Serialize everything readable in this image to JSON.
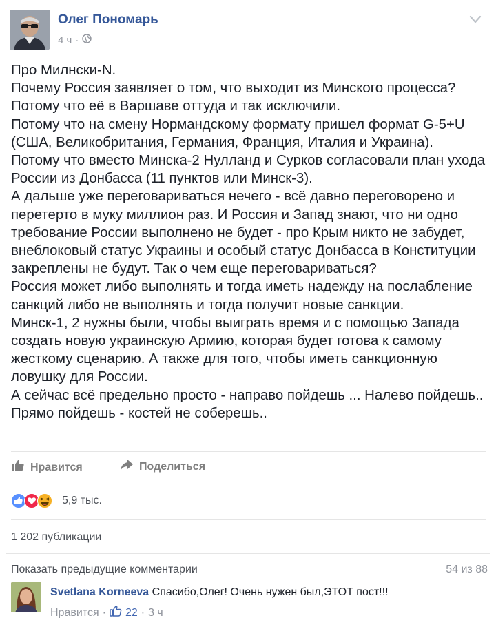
{
  "post": {
    "author": "Олег Пономарь",
    "time": "4 ч",
    "separator": "·",
    "lines": [
      "Про Милнски-N.",
      "Почему Россия заявляет о том, что выходит из Минского процесса?",
      "Потому что её в Варшаве оттуда и так исключили.",
      "Потому что на смену Нормандскому формату пришел формат G-5+U",
      "(США, Великобритания, Германия, Франция, Италия и Украина).",
      "Потому что вместо Минска-2 Нулланд и Сурков согласовали план ухода",
      "России из Донбасса (11 пунктов или Минск-3).",
      "А дальше уже переговариваться нечего - всё давно переговорено и",
      "перетерто в муку миллион раз. И Россия и Запад знают, что ни одно",
      "требование России выполнено не будет - про Крым никто не забудет,",
      "внеблоковый статус Украины и особый статус Донбасса в Конституции",
      "закреплены не будут. Так о чем еще переговариваться?",
      "Россия может либо выполнять и тогда иметь надежду на послабление",
      "санкций либо не выполнять и тогда получит новые санкции.",
      "Минск-1, 2 нужны были, чтобы выиграть время и с помощью Запада",
      "создать новую украинскую Армию, которая будет готова к самому",
      "жесткому сценарию. А также для того, чтобы иметь санкционную",
      "ловушку для России.",
      "А сейчас всё предельно просто - направо пойдешь ... Налево пойдешь..",
      "Прямо пойдешь - костей не соберешь.."
    ]
  },
  "actions": {
    "like_label": "Нравится",
    "share_label": "Поделиться"
  },
  "reactions": {
    "count": "5,9 тыс.",
    "icons": [
      "like-reaction-icon",
      "love-reaction-icon",
      "haha-reaction-icon"
    ]
  },
  "shares": {
    "label": "1 202 публикации"
  },
  "comments": {
    "show_previous": "Показать предыдущие комментарии",
    "counter": "54 из 88",
    "items": [
      {
        "author": "Svetlana Korneeva",
        "text": " Спасибо,Олег! Очень нужен был,ЭТОТ пост!!!",
        "like_label": "Нравится",
        "like_count": "22",
        "time": "3 ч",
        "separator": "·"
      }
    ]
  },
  "colors": {
    "link": "#365899",
    "text": "#1d2129",
    "meta": "#90949c",
    "like_blue": "#5890ff",
    "love_red": "#f0284a",
    "haha_yellow": "#f7b125"
  }
}
